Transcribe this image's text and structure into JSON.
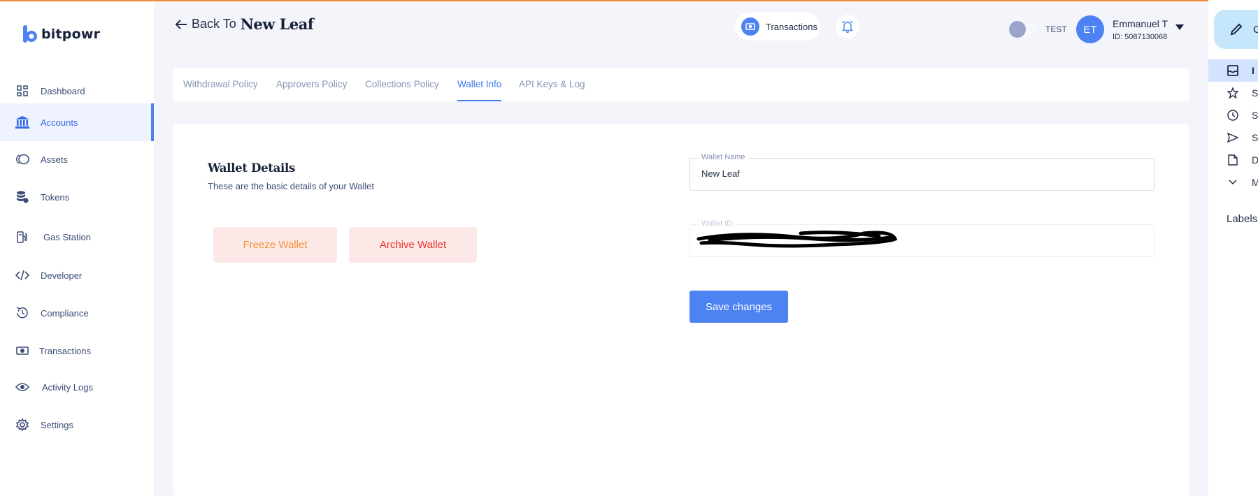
{
  "brand": {
    "name": "bitpowr",
    "accent": "#4c82f1"
  },
  "sidebar": {
    "items": [
      {
        "label": "Dashboard",
        "icon": "grid-icon"
      },
      {
        "label": "Accounts",
        "icon": "bank-icon",
        "active": true
      },
      {
        "label": "Assets",
        "icon": "assets-icon"
      },
      {
        "label": "Tokens",
        "icon": "coins-stack-icon"
      },
      {
        "label": "Gas Station",
        "icon": "fuel-pump-icon"
      },
      {
        "label": "Developer",
        "icon": "code-icon"
      },
      {
        "label": "Compliance",
        "icon": "refresh-check-icon"
      },
      {
        "label": "Transactions",
        "icon": "banknote-icon"
      },
      {
        "label": "Activity Logs",
        "icon": "eye-icon"
      },
      {
        "label": "Settings",
        "icon": "gear-icon"
      }
    ]
  },
  "header": {
    "back_prefix": "Back To",
    "back_name": "New Leaf",
    "transactions_label": "Transactions",
    "env_label": "TEST",
    "user": {
      "initials": "ET",
      "name": "Emmanuel T",
      "id": "ID: 5087130068"
    }
  },
  "tabs": [
    {
      "label": "Withdrawal Policy"
    },
    {
      "label": "Approvers Policy"
    },
    {
      "label": "Collections Policy"
    },
    {
      "label": "Wallet Info",
      "active": true
    },
    {
      "label": "API Keys & Log"
    }
  ],
  "wallet": {
    "title": "Wallet Details",
    "subtitle": "These are the basic details of your Wallet",
    "freeze_label": "Freeze Wallet",
    "archive_label": "Archive Wallet",
    "name_field": {
      "label": "Wallet Name",
      "value": "New Leaf"
    },
    "id_field": {
      "label": "Wallet ID",
      "value": ""
    },
    "save_label": "Save changes"
  },
  "right_panel": {
    "compose_label": "C",
    "items": [
      {
        "label": "I",
        "icon": "inbox-icon",
        "active": true
      },
      {
        "label": "S",
        "icon": "star-icon"
      },
      {
        "label": "S",
        "icon": "clock-icon"
      },
      {
        "label": "S",
        "icon": "send-icon"
      },
      {
        "label": "D",
        "icon": "file-icon"
      },
      {
        "label": "M",
        "icon": "chevron-down-icon"
      }
    ],
    "labels_heading": "Labels"
  }
}
